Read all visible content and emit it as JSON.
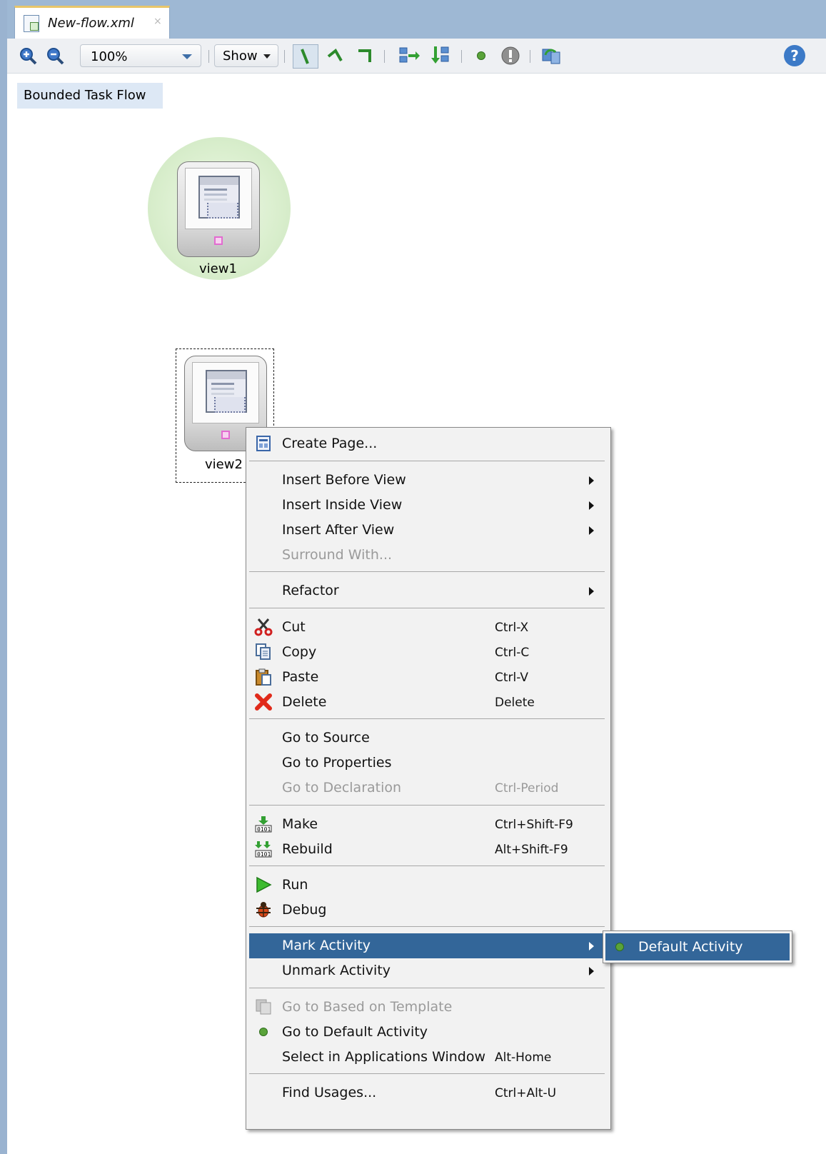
{
  "editor": {
    "tab_title": "New-flow.xml",
    "tab_close": "×",
    "zoom_value": "100%",
    "show_label": "Show",
    "help_glyph": "?"
  },
  "canvas": {
    "flow_type_label": "Bounded Task Flow",
    "activities": [
      {
        "label": "view1",
        "default": true
      },
      {
        "label": "view2",
        "selected": true
      }
    ]
  },
  "context_menu": {
    "create_page": "Create Page...",
    "insert_before_view": "Insert Before View",
    "insert_inside_view": "Insert Inside View",
    "insert_after_view": "Insert After View",
    "surround_with": "Surround With...",
    "refactor": "Refactor",
    "cut": "Cut",
    "cut_shortcut": "Ctrl-X",
    "copy": "Copy",
    "copy_shortcut": "Ctrl-C",
    "paste": "Paste",
    "paste_shortcut": "Ctrl-V",
    "delete": "Delete",
    "delete_shortcut": "Delete",
    "go_to_source": "Go to Source",
    "go_to_properties": "Go to Properties",
    "go_to_declaration": "Go to Declaration",
    "go_to_declaration_shortcut": "Ctrl-Period",
    "make": "Make",
    "make_shortcut": "Ctrl+Shift-F9",
    "rebuild": "Rebuild",
    "rebuild_shortcut": "Alt+Shift-F9",
    "run": "Run",
    "debug": "Debug",
    "mark_activity": "Mark Activity",
    "unmark_activity": "Unmark Activity",
    "go_to_based_on_template": "Go to Based on Template",
    "go_to_default_activity": "Go to Default Activity",
    "select_in_applications_window": "Select in Applications Window",
    "select_in_applications_window_shortcut": "Alt-Home",
    "find_usages": "Find Usages...",
    "find_usages_shortcut": "Ctrl+Alt-U"
  },
  "submenu": {
    "default_activity": "Default Activity"
  },
  "colors": {
    "menu_highlight": "#336699",
    "default_activity_glow": "#dbefcf",
    "tab_bar": "#9eb8d4"
  }
}
